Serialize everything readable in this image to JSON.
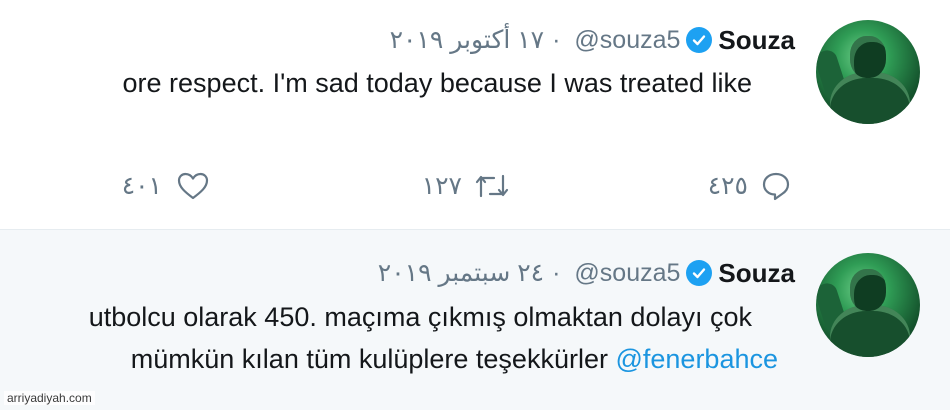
{
  "tweets": [
    {
      "name": "Souza",
      "handle": "@souza5",
      "separator": "·",
      "date": "١٧ أكتوبر ٢٠١٩",
      "text_lines": [
        "ore respect.  I'm sad today because I was treated like"
      ],
      "replies": "٤٢٥",
      "retweets": "١٢٧",
      "likes": "٤٠١"
    },
    {
      "name": "Souza",
      "handle": "@souza5",
      "separator": "·",
      "date": "٢٤ سبتمبر ٢٠١٩",
      "text_line1": "utbolcu olarak 450. maçıma çıkmış olmaktan dolayı çok",
      "text_line2": "mümkün kılan tüm kulüplere teşekkürler",
      "mention": "@fenerbahce"
    }
  ],
  "watermark": "arriyadiyah.com",
  "colors": {
    "verified": "#1da1f2",
    "mention": "#1b95e0",
    "muted": "#657786"
  },
  "icons": [
    "verified-badge-icon",
    "reply-icon",
    "retweet-icon",
    "like-icon",
    "avatar-photo"
  ]
}
